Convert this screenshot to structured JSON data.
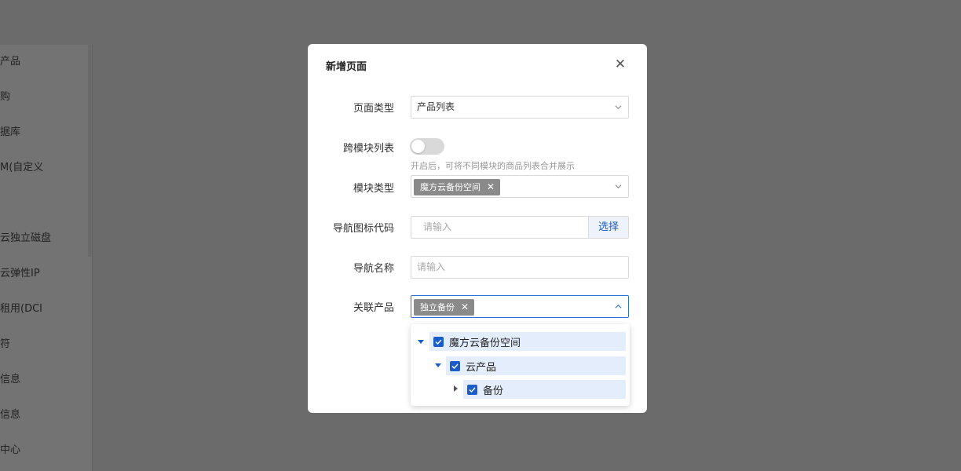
{
  "sidebar": {
    "items": [
      {
        "label": "产品"
      },
      {
        "label": "购"
      },
      {
        "label": "据库"
      },
      {
        "label": "M(自定义"
      },
      {
        "label": "云独立磁盘"
      },
      {
        "label": "云弹性IP"
      },
      {
        "label": "租用(DCI"
      },
      {
        "label": "符"
      },
      {
        "label": "信息"
      },
      {
        "label": "信息"
      },
      {
        "label": "中心"
      }
    ]
  },
  "dialog": {
    "title": "新增页面",
    "fields": {
      "page_type": {
        "label": "页面类型",
        "value": "产品列表"
      },
      "cross_module": {
        "label": "跨模块列表",
        "enabled": false,
        "hint": "开启后，可将不同模块的商品列表合并展示"
      },
      "module_type": {
        "label": "模块类型",
        "tags": [
          "魔方云备份空间"
        ]
      },
      "nav_icon_code": {
        "label": "导航图标代码",
        "placeholder": "请输入",
        "button": "选择"
      },
      "nav_name": {
        "label": "导航名称",
        "placeholder": "请输入"
      },
      "related_product": {
        "label": "关联产品",
        "tags": [
          "独立备份"
        ]
      }
    },
    "tree": [
      {
        "label": "魔方云备份空间",
        "level": 0,
        "expanded": true,
        "checked": true
      },
      {
        "label": "云产品",
        "level": 1,
        "expanded": true,
        "checked": true
      },
      {
        "label": "备份",
        "level": 2,
        "expanded": false,
        "checked": true
      }
    ]
  },
  "colors": {
    "primary": "#1a5dc8",
    "overlay": "#6b6b6b",
    "tag_bg": "#8a8a8a",
    "tree_row_bg": "#e3edfc"
  }
}
